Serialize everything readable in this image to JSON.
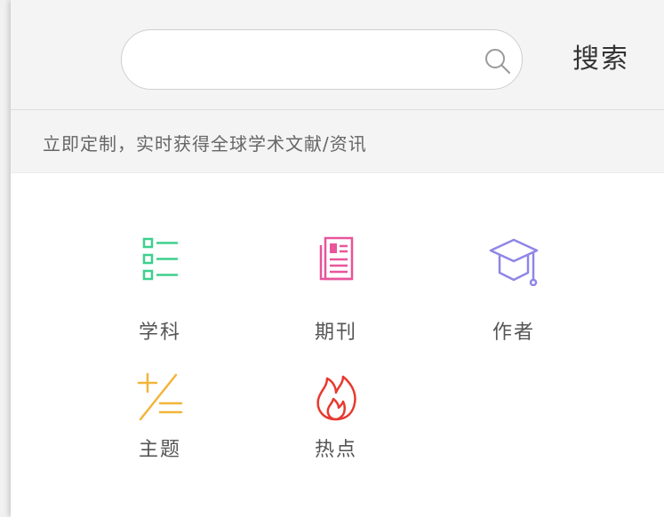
{
  "search": {
    "value": "",
    "placeholder": "",
    "button_label": "搜索"
  },
  "notice": {
    "text": "立即定制，实时获得全球学术文献/资讯"
  },
  "categories": [
    {
      "label": "学科",
      "icon": "list-icon",
      "color": "#3ecf8e"
    },
    {
      "label": "期刊",
      "icon": "journal-icon",
      "color": "#e8559b"
    },
    {
      "label": "作者",
      "icon": "graduation-cap-icon",
      "color": "#8f86e6"
    },
    {
      "label": "主题",
      "icon": "plus-slash-equals-icon",
      "color": "#f2b53a"
    },
    {
      "label": "热点",
      "icon": "flame-icon",
      "color": "#e8392f"
    }
  ]
}
